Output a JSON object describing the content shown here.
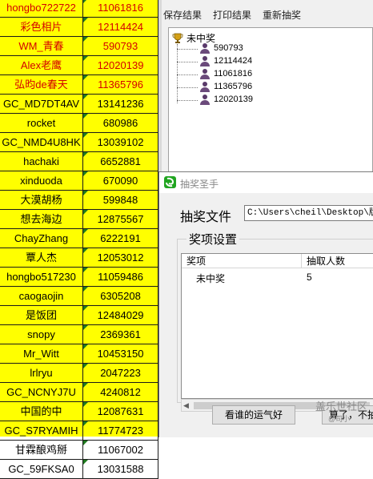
{
  "sheet": {
    "rows": [
      {
        "name": "hongbo722722",
        "num": "11061816",
        "red": true
      },
      {
        "name": "彩色相片",
        "num": "12114424",
        "red": true
      },
      {
        "name": "WM_青春",
        "num": "590793",
        "red": true
      },
      {
        "name": "Alex老鹰",
        "num": "12020139",
        "red": true
      },
      {
        "name": "弘昀de春天",
        "num": "11365796",
        "red": true
      },
      {
        "name": "GC_MD7DT4AV",
        "num": "13141236",
        "red": false
      },
      {
        "name": "rocket",
        "num": "680986",
        "red": false
      },
      {
        "name": "GC_NMD4U8HK",
        "num": "13039102",
        "red": false
      },
      {
        "name": "hachaki",
        "num": "6652881",
        "red": false
      },
      {
        "name": "xinduoda",
        "num": "670090",
        "red": false
      },
      {
        "name": "大漠胡杨",
        "num": "599848",
        "red": false
      },
      {
        "name": "想去海边",
        "num": "12875567",
        "red": false
      },
      {
        "name": "ChayZhang",
        "num": "6222191",
        "red": false
      },
      {
        "name": "覃人杰",
        "num": "12053012",
        "red": false
      },
      {
        "name": "hongbo517230",
        "num": "11059486",
        "red": false
      },
      {
        "name": "caogaojin",
        "num": "6305208",
        "red": false
      },
      {
        "name": "是饭团",
        "num": "12484029",
        "red": false
      },
      {
        "name": "snopy",
        "num": "2369361",
        "red": false
      },
      {
        "name": "Mr_Witt",
        "num": "10453150",
        "red": false
      },
      {
        "name": "lrlryu",
        "num": "2047223",
        "red": false
      },
      {
        "name": "GC_NCNYJ7U",
        "num": "4240812",
        "red": false
      },
      {
        "name": "中国的中",
        "num": "12087631",
        "red": false
      },
      {
        "name": "GC_S7RYAMIH",
        "num": "11774723",
        "red": false
      },
      {
        "name": "甘霖酿鸡掰",
        "num": "11067002",
        "red": false
      },
      {
        "name": "GC_59FKSA0",
        "num": "13031588",
        "red": false
      }
    ]
  },
  "result_window": {
    "menu": [
      "保存结果",
      "打印结果",
      "重新抽奖"
    ],
    "tree": {
      "root_label": "未中奖",
      "root_icon": "trophy-icon",
      "leaves": [
        "590793",
        "12114424",
        "11061816",
        "11365796",
        "12020139"
      ],
      "leaf_icon": "person-icon"
    }
  },
  "lottery_window": {
    "title": "抽奖圣手",
    "file_label": "抽奖文件",
    "file_path": "C:\\Users\\cheil\\Desktop\\版块",
    "prize_group_label": "奖项设置",
    "columns": [
      "奖项",
      "抽取人数"
    ],
    "rows": [
      {
        "prize": "未中奖",
        "count": "5"
      }
    ],
    "buttons": {
      "lucky": "看谁的运气好",
      "done": "算了，不抽"
    }
  },
  "watermark": {
    "line1": "盖乐世社区",
    "line2": "@司小"
  },
  "colors": {
    "sheet_bg": "#ffff00",
    "red_text": "#d40000",
    "accent_green": "#21a521"
  }
}
